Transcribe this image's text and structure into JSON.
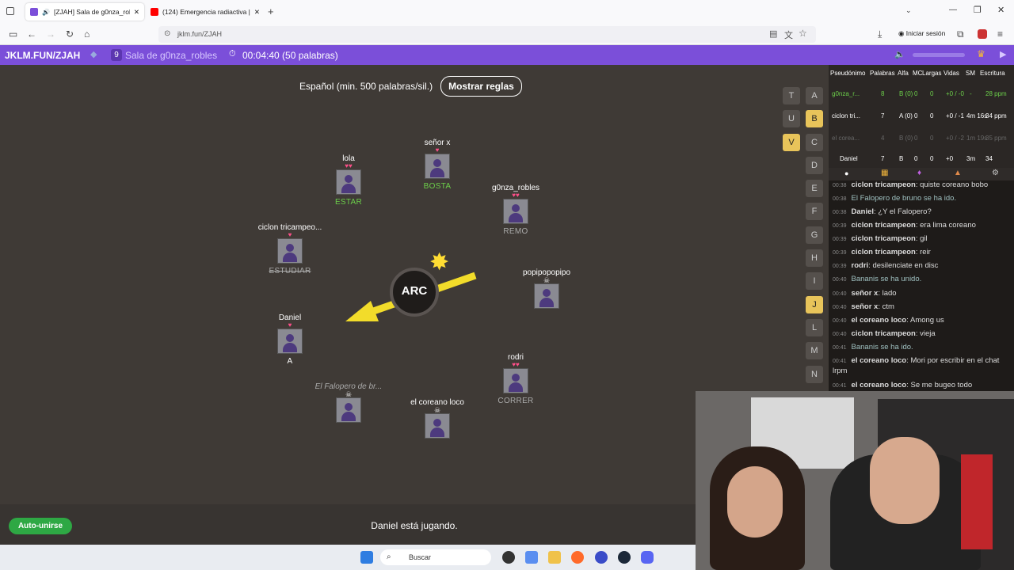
{
  "browser": {
    "tabs": [
      {
        "label": "[ZJAH] Sala de g0nza_robles"
      },
      {
        "label": "(124) Emergencia radiactiva | 2("
      }
    ],
    "url": "jklm.fun/ZJAH",
    "signin": "Iniciar sesión"
  },
  "header": {
    "brand": "JKLM.FUN/ZJAH",
    "room_count": "9",
    "room_name": "Sala de g0nza_robles",
    "timer": "00:04:40 (50 palabras)"
  },
  "game": {
    "language": "Español (min. 500 palabras/sil.)",
    "rules_button": "Mostrar reglas",
    "syllable": "ARC",
    "status": "Daniel está jugando.",
    "autojoin": "Auto-unirse",
    "players": [
      {
        "name": "lola",
        "hearts": "♥♥",
        "word": "ESTAR"
      },
      {
        "name": "señor x",
        "hearts": "♥",
        "word": "BOSTA"
      },
      {
        "name": "g0nza_robles",
        "hearts": "♥♥",
        "word": "REMO"
      },
      {
        "name": "ciclon tricampeo...",
        "hearts": "♥",
        "word": "ESTUDIAR"
      },
      {
        "name": "popipopopipo",
        "hearts": "",
        "word": ""
      },
      {
        "name": "Daniel",
        "hearts": "♥",
        "word": "A"
      },
      {
        "name": "rodri",
        "hearts": "♥♥",
        "word": "CORRER"
      },
      {
        "name": "El Falopero de br...",
        "hearts": "",
        "word": ""
      },
      {
        "name": "el coreano loco",
        "hearts": "",
        "word": ""
      }
    ]
  },
  "letters": [
    "T",
    "A",
    "U",
    "B",
    "V",
    "C",
    "D",
    "E",
    "F",
    "G",
    "H",
    "I",
    "J",
    "L",
    "M",
    "N"
  ],
  "scoreboard": {
    "headers": [
      "Pseudónimo",
      "Palabras",
      "Alfa",
      "MC",
      "Largas",
      "Vidas",
      "SM",
      "Escritura"
    ],
    "rows": [
      {
        "name": "g0nza_r...",
        "words": "8",
        "alfa": "B (0)",
        "mc": "0",
        "largas": "0",
        "vidas": "+0 / -0",
        "sm": "-",
        "esc": "28 ppm"
      },
      {
        "name": "ciclon tri...",
        "words": "7",
        "alfa": "A (0)",
        "mc": "0",
        "largas": "0",
        "vidas": "+0 / -1",
        "sm": "4m 16s",
        "esc": "34 ppm"
      },
      {
        "name": "el corea...",
        "words": "4",
        "alfa": "B (0)",
        "mc": "0",
        "largas": "0",
        "vidas": "+0 / -2",
        "sm": "1m 19s",
        "esc": "35 ppm"
      },
      {
        "name": "Daniel",
        "words": "7",
        "alfa": "B",
        "mc": "0",
        "largas": "0",
        "vidas": "+0",
        "sm": "3m",
        "esc": "34"
      }
    ]
  },
  "chat": [
    {
      "time": "00:38",
      "user": "ciclon tricampeon",
      "text": "quiste coreano bobo"
    },
    {
      "time": "00:38",
      "user": "",
      "text": "El Falopero de bruno se ha ido."
    },
    {
      "time": "00:38",
      "user": "Daniel",
      "text": "¿Y el Falopero?"
    },
    {
      "time": "00:39",
      "user": "ciclon tricampeon",
      "text": "era lima coreano"
    },
    {
      "time": "00:39",
      "user": "ciclon tricampeon",
      "text": "gil"
    },
    {
      "time": "00:39",
      "user": "ciclon tricampeon",
      "text": "reir"
    },
    {
      "time": "00:39",
      "user": "rodri",
      "text": "desilenciate en disc"
    },
    {
      "time": "00:40",
      "user": "",
      "text": "Bananis se ha unido."
    },
    {
      "time": "00:40",
      "user": "señor x",
      "text": "lado"
    },
    {
      "time": "00:40",
      "user": "señor x",
      "text": "ctm"
    },
    {
      "time": "00:40",
      "user": "el coreano loco",
      "text": "Among us"
    },
    {
      "time": "00:40",
      "user": "ciclon tricampeon",
      "text": "vieja"
    },
    {
      "time": "00:41",
      "user": "",
      "text": "Bananis se ha ido."
    },
    {
      "time": "00:41",
      "user": "el coreano loco",
      "text": "Mori por escribir en el chat lrpm"
    },
    {
      "time": "00:41",
      "user": "el coreano loco",
      "text": "Se me bugeo todo"
    }
  ],
  "taskbar": {
    "search": "Buscar"
  }
}
